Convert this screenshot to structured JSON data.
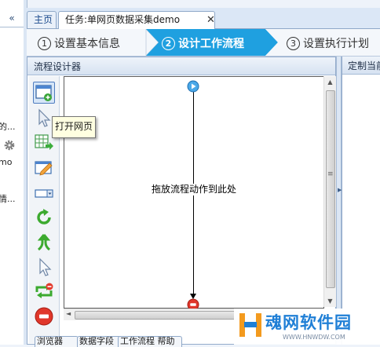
{
  "left_pane": {
    "collapse_label": "«",
    "fragments": [
      "的...",
      "mo",
      "情..."
    ]
  },
  "tabs": {
    "home": "主页",
    "task": "任务:单网页数据采集demo",
    "close": "✕"
  },
  "wizard": {
    "steps": [
      {
        "num": "1",
        "label": "设置基本信息"
      },
      {
        "num": "2",
        "label": "设计工作流程"
      },
      {
        "num": "3",
        "label": "设置执行计划"
      }
    ],
    "active_step": 2,
    "active_color": "#1fa0e0"
  },
  "designer": {
    "title": "流程设计器",
    "drop_hint": "拖放流程动作到此处",
    "tooltip": "打开网页",
    "tools": [
      "open-page-icon",
      "click-element-icon",
      "extract-data-icon",
      "input-text-icon",
      "switch-dropdown-icon",
      "loop-icon",
      "condition-branch-icon",
      "mouse-hover-icon",
      "loop-page-icon",
      "stop-icon"
    ]
  },
  "right_panel": {
    "title": "定制当前"
  },
  "bottom_tabs": [
    "浏览器",
    "数据字段",
    "工作流程 帮助"
  ],
  "watermark": {
    "text": "魂网软件园",
    "url": "WWW.HNWDW.COM"
  }
}
